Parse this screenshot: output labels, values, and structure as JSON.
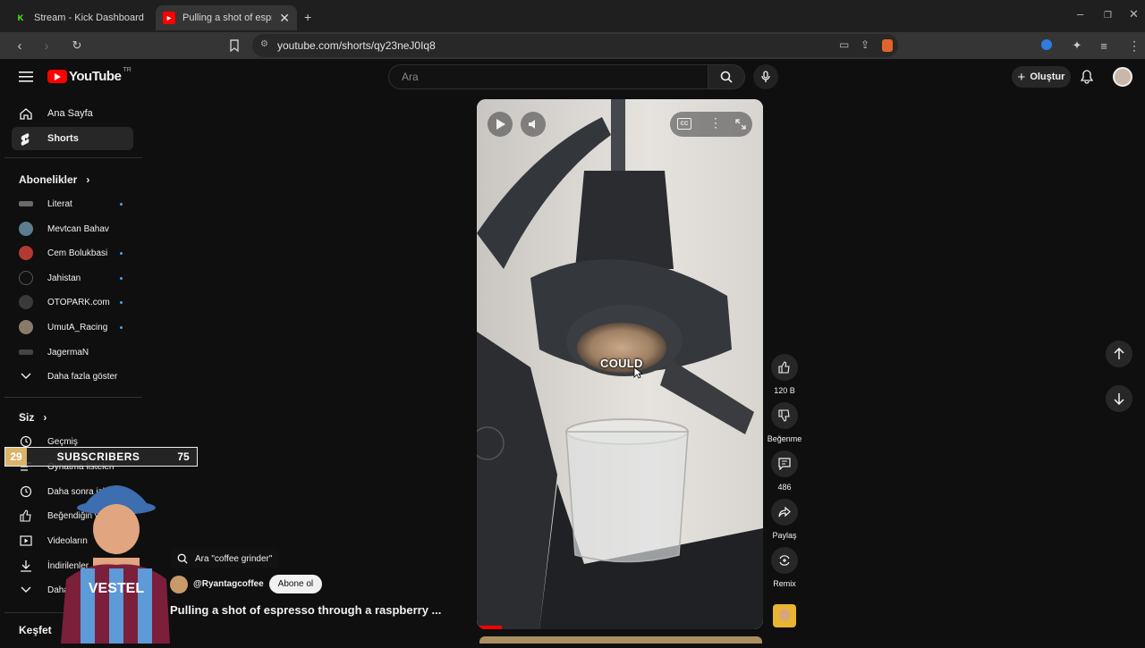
{
  "browser": {
    "tabs": [
      {
        "title": "Stream - Kick Dashboard",
        "favicon": "K",
        "favicon_color": "#53fc18"
      },
      {
        "title": "Pulling a shot of espresso t",
        "favicon": "▶",
        "favicon_color": "#ff0000",
        "active": true
      }
    ],
    "url": "youtube.com/shorts/qy23neJ0Iq8"
  },
  "header": {
    "logo_text": "YouTube",
    "region": "TR",
    "search_placeholder": "Ara",
    "create_label": "Oluştur"
  },
  "sidebar": {
    "main": [
      {
        "label": "Ana Sayfa",
        "icon": "home-icon"
      },
      {
        "label": "Shorts",
        "icon": "shorts-icon",
        "selected": true
      }
    ],
    "subscriptions_title": "Abonelikler",
    "subscriptions": [
      {
        "label": "Literat",
        "color": "#6a6a6a",
        "dot": true
      },
      {
        "label": "Mevtcan Bahav",
        "color": "#5c7d8f",
        "dot": false
      },
      {
        "label": "Cem Bolukbasi",
        "color": "#b23a32",
        "dot": true
      },
      {
        "label": "Jahistan",
        "color": "#222222",
        "dot": true
      },
      {
        "label": "OTOPARK.com",
        "color": "#3a3a3a",
        "dot": true
      },
      {
        "label": "UmutA_Racing",
        "color": "#8a7a6a",
        "dot": true
      },
      {
        "label": "JagermaN",
        "color": "#444444",
        "dot": false
      }
    ],
    "show_more": "Daha fazla göster",
    "you_title": "Siz",
    "you_items": [
      {
        "label": "Geçmiş",
        "icon": "history-icon"
      },
      {
        "label": "Oynatma listeleri",
        "icon": "playlist-icon"
      },
      {
        "label": "Daha sonra izle",
        "icon": "clock-icon"
      },
      {
        "label": "Beğendiğin videolar",
        "icon": "thumb-up-icon"
      },
      {
        "label": "Videoların",
        "icon": "video-icon"
      },
      {
        "label": "İndirilenler",
        "icon": "download-icon"
      },
      {
        "label": "Daha fazla göster",
        "icon": "chevron-down-icon"
      }
    ],
    "explore_title": "Keşfet"
  },
  "short": {
    "caption_word": "COULD",
    "actions": [
      {
        "label": "120 B",
        "icon": "thumb-up-icon"
      },
      {
        "label": "Beğenme",
        "icon": "thumb-down-icon"
      },
      {
        "label": "486",
        "icon": "comment-icon"
      },
      {
        "label": "Paylaş",
        "icon": "share-icon"
      },
      {
        "label": "Remix",
        "icon": "remix-icon"
      }
    ],
    "search_chip": "Ara \"coffee grinder\"",
    "channel": "@Ryantagcoffee",
    "subscribe_label": "Abone ol",
    "title": "Pulling a shot of espresso through a raspberry ..."
  },
  "overlay": {
    "sub_count_left": "29",
    "sub_label": "SUBSCRIBERS",
    "sub_count_right": "75"
  }
}
